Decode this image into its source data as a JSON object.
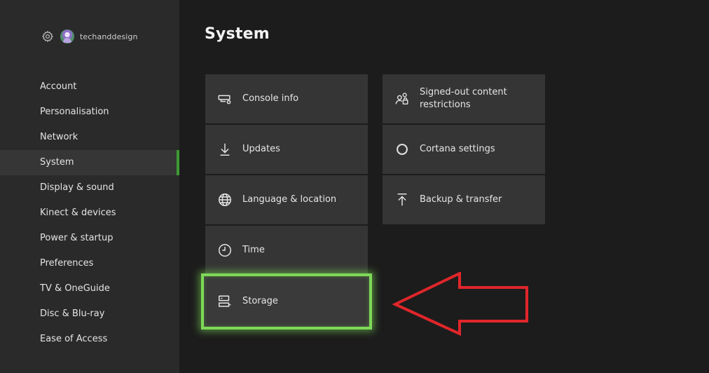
{
  "profile": {
    "gamertag": "techanddesign",
    "settings_icon": "gear-icon",
    "avatar_icon": "avatar"
  },
  "sidebar": {
    "items": [
      {
        "label": "Account",
        "selected": false
      },
      {
        "label": "Personalisation",
        "selected": false
      },
      {
        "label": "Network",
        "selected": false
      },
      {
        "label": "System",
        "selected": true
      },
      {
        "label": "Display & sound",
        "selected": false
      },
      {
        "label": "Kinect & devices",
        "selected": false
      },
      {
        "label": "Power & startup",
        "selected": false
      },
      {
        "label": "Preferences",
        "selected": false
      },
      {
        "label": "TV & OneGuide",
        "selected": false
      },
      {
        "label": "Disc & Blu-ray",
        "selected": false
      },
      {
        "label": "Ease of Access",
        "selected": false
      }
    ]
  },
  "main": {
    "title": "System",
    "left_column": [
      {
        "label": "Console info",
        "icon": "console-icon"
      },
      {
        "label": "Updates",
        "icon": "download-icon"
      },
      {
        "label": "Language & location",
        "icon": "globe-icon"
      },
      {
        "label": "Time",
        "icon": "clock-icon"
      },
      {
        "label": "Storage",
        "icon": "storage-icon",
        "focused": true
      }
    ],
    "right_column": [
      {
        "label": "Signed-out content restrictions",
        "icon": "user-lock-icon"
      },
      {
        "label": "Cortana settings",
        "icon": "cortana-icon"
      },
      {
        "label": "Backup & transfer",
        "icon": "upload-icon"
      }
    ]
  },
  "colors": {
    "accent_green": "#3d9b32",
    "focus_highlight": "#7ed957",
    "annotation_arrow": "#e0262a",
    "tile_background": "#353535",
    "sidebar_background": "#2a2a2a"
  },
  "annotation": {
    "type": "arrow",
    "points_to": "Storage"
  }
}
